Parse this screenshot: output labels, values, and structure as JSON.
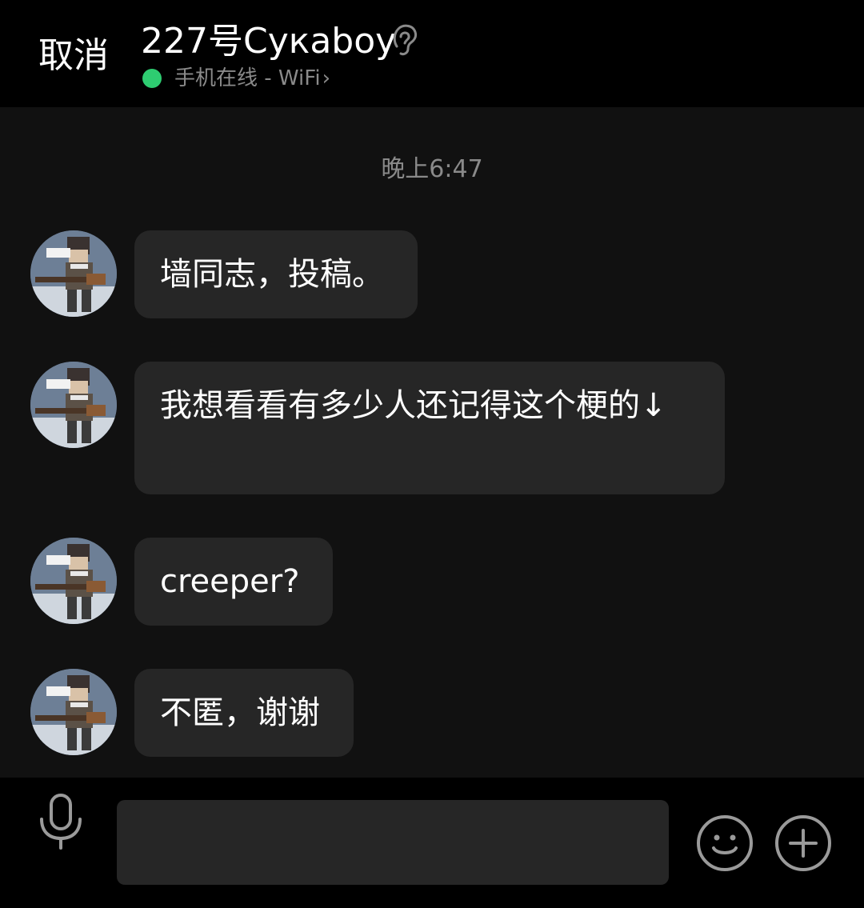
{
  "header": {
    "cancel_label": "取消",
    "title": "227号Cyкaboy",
    "status_text": "手机在线 - WiFi",
    "status_chevron": "›",
    "status_color": "#2ecc71",
    "ear_icon": "ear-icon"
  },
  "chat": {
    "timestamp": "晚上6:47",
    "messages": [
      {
        "text": "墙同志，投稿。"
      },
      {
        "text": "我想看看有多少人还记得这个梗的↓"
      },
      {
        "text": "creeper?"
      },
      {
        "text": "不匿，谢谢"
      }
    ]
  },
  "input_bar": {
    "placeholder": "",
    "mic_icon": "microphone-icon",
    "emoji_icon": "smiley-icon",
    "plus_icon": "plus-icon"
  },
  "colors": {
    "background": "#000000",
    "chat_background": "#111111",
    "bubble": "#262626",
    "muted_text": "#8a8a8a",
    "online_dot": "#2ecc71"
  }
}
